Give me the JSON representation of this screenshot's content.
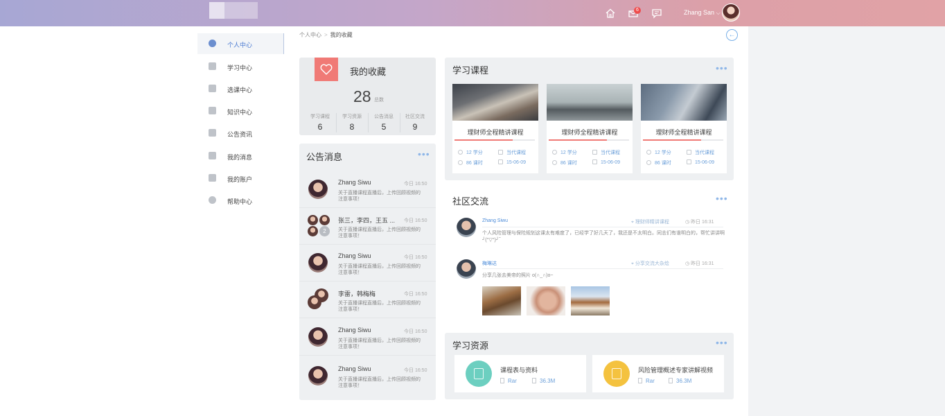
{
  "header": {
    "user_name": "Zhang San",
    "user_caret": "⌵",
    "notification_count": "6",
    "icons": [
      "home-icon",
      "notification-icon",
      "message-icon"
    ]
  },
  "sidebar": {
    "items": [
      {
        "label": "个人中心",
        "icon": "user-icon",
        "active": true
      },
      {
        "label": "学习中心",
        "icon": "edit-icon"
      },
      {
        "label": "选课中心",
        "icon": "book-icon"
      },
      {
        "label": "知识中心",
        "icon": "open-book-icon"
      },
      {
        "label": "公告资讯",
        "icon": "clipboard-icon"
      },
      {
        "label": "我的消息",
        "icon": "chat-icon"
      },
      {
        "label": "我的账户",
        "icon": "yen-icon"
      },
      {
        "label": "帮助中心",
        "icon": "help-icon"
      }
    ]
  },
  "breadcrumb": {
    "home": "个人中心",
    "sep": ">",
    "current": "我的收藏"
  },
  "favorites": {
    "title": "我的收藏",
    "total": "28",
    "total_label": "总数",
    "stats": [
      {
        "label": "学习课程",
        "value": "6"
      },
      {
        "label": "学习资源",
        "value": "8"
      },
      {
        "label": "公告消息",
        "value": "5"
      },
      {
        "label": "社区交流",
        "value": "9"
      }
    ]
  },
  "announcements": {
    "title": "公告消息",
    "more": "•••",
    "items": [
      {
        "name": "Zhang Siwu",
        "time": "今日  16:50",
        "text": "关于直播课程直播后，上传回顾视频的注意事项！"
      },
      {
        "name": "张三，李四，王五 ...",
        "time": "今日  16:50",
        "text": "关于直播课程直播后，上传回顾视频的注意事项！",
        "extra_count": "2"
      },
      {
        "name": "Zhang Siwu",
        "time": "今日  16:50",
        "text": "关于直播课程直播后，上传回顾视频的注意事项！"
      },
      {
        "name": "李雷，韩梅梅",
        "time": "今日  16:50",
        "text": "关于直播课程直播后，上传回顾视频的注意事项！"
      },
      {
        "name": "Zhang Siwu",
        "time": "今日  16:50",
        "text": "关于直播课程直播后，上传回顾视频的注意事项！"
      },
      {
        "name": "Zhang Siwu",
        "time": "今日  16:50",
        "text": "关于直播课程直播后，上传回顾视频的注意事项！"
      }
    ]
  },
  "courses": {
    "title": "学习课程",
    "more": "•••",
    "items": [
      {
        "name": "理财师全程精讲课程",
        "credits": "12  学分",
        "teacher": "当代课程",
        "hours": "86  课时",
        "date": "15-06-09",
        "progress": 0.72
      },
      {
        "name": "理财师全程精讲课程",
        "credits": "12  学分",
        "teacher": "当代课程",
        "hours": "86  课时",
        "date": "15-06-09",
        "progress": 0.72
      },
      {
        "name": "理财师全程精讲课程",
        "credits": "12  学分",
        "teacher": "当代课程",
        "hours": "86  课时",
        "date": "15-06-09",
        "progress": 0.72
      }
    ]
  },
  "community": {
    "title": "社区交流",
    "more": "•••",
    "posts": [
      {
        "name": "Zhang Siwu",
        "tag": "理财师精讲课程",
        "time": "昨日  16:31",
        "text": "个人风险管理与保险规划这课太有难度了，已经学了好几天了，我还是不太明白。同志们有谁明白的，帮忙讲讲啊         ╯(°▽°)╯‾"
      },
      {
        "name": "梅琳达",
        "tag": "分享交流大杂烩",
        "time": "昨日  16:31",
        "text": "分享几张去美帝的照片 o(∩_∩)o~"
      }
    ]
  },
  "resources": {
    "title": "学习资源",
    "more": "•••",
    "items": [
      {
        "name": "课程表与资料",
        "type": "Rar",
        "size": "36.3M",
        "color": "#6ccfc0",
        "icon": "document-icon"
      },
      {
        "name": "风险管理概述专家讲解视频",
        "type": "Rar",
        "size": "36.3M",
        "color": "#f4c23f",
        "icon": "video-icon"
      }
    ]
  },
  "colors": {
    "accent": "#4a8ad8",
    "heart": "#f07a76",
    "badge": "#ef4b4b"
  }
}
